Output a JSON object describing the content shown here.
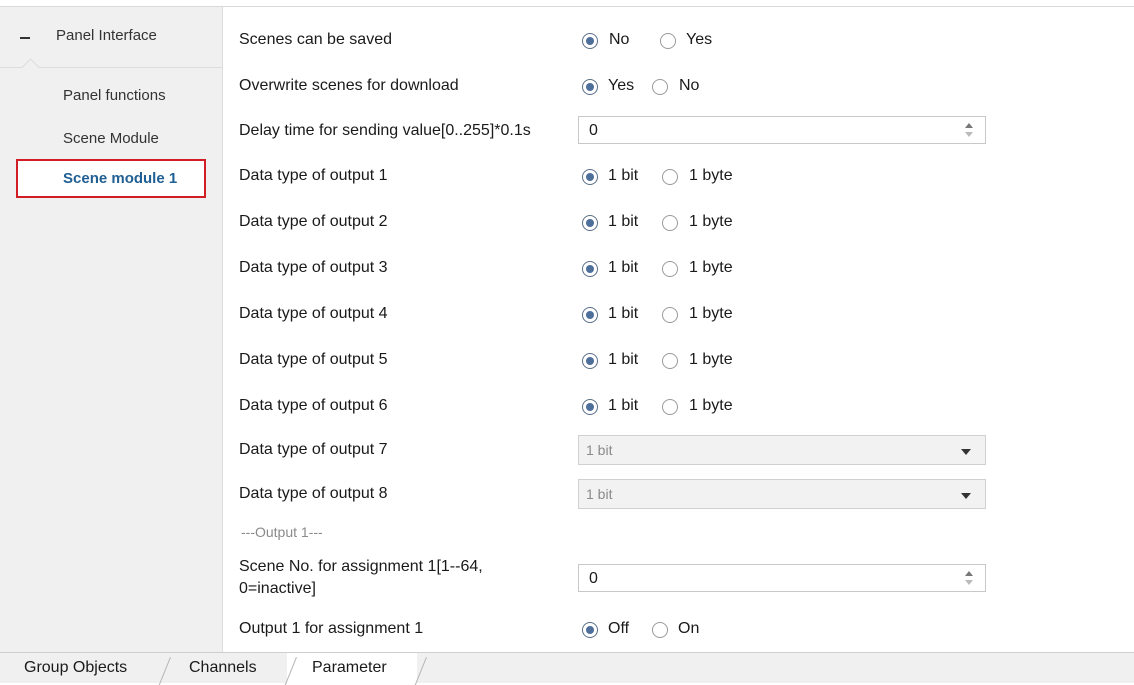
{
  "sidebar": {
    "root_label": "Panel Interface",
    "items": [
      "Panel functions",
      "Scene Module"
    ],
    "selected": "Scene module 1"
  },
  "params": {
    "scenes_saved": {
      "label": "Scenes can be saved",
      "opt1": "No",
      "opt2": "Yes",
      "selected": "No"
    },
    "overwrite": {
      "label": "Overwrite scenes for download",
      "opt1": "Yes",
      "opt2": "No",
      "selected": "Yes"
    },
    "delay": {
      "label": "Delay time for sending value[0..255]*0.1s",
      "value": "0"
    },
    "out1": {
      "label": "Data type of output 1",
      "opt1": "1 bit",
      "opt2": "1 byte",
      "selected": "1 bit"
    },
    "out2": {
      "label": "Data type of output 2",
      "opt1": "1 bit",
      "opt2": "1 byte",
      "selected": "1 bit"
    },
    "out3": {
      "label": "Data type of output 3",
      "opt1": "1 bit",
      "opt2": "1 byte",
      "selected": "1 bit"
    },
    "out4": {
      "label": "Data type of output 4",
      "opt1": "1 bit",
      "opt2": "1 byte",
      "selected": "1 bit"
    },
    "out5": {
      "label": "Data type of output 5",
      "opt1": "1 bit",
      "opt2": "1 byte",
      "selected": "1 bit"
    },
    "out6": {
      "label": "Data type of output 6",
      "opt1": "1 bit",
      "opt2": "1 byte",
      "selected": "1 bit"
    },
    "out7": {
      "label": "Data type of output 7",
      "value": "1 bit"
    },
    "out8": {
      "label": "Data type of output 8",
      "value": "1 bit"
    },
    "section_output1": "---Output 1---",
    "scene_no": {
      "label_line1": "Scene No. for assignment 1[1--64,",
      "label_line2": "0=inactive]",
      "value": "0"
    },
    "out1_assign": {
      "label": "Output 1 for assignment 1",
      "opt1": "Off",
      "opt2": "On",
      "selected": "Off"
    }
  },
  "tabs": [
    "Group Objects",
    "Channels",
    "Parameter"
  ],
  "active_tab": "Parameter",
  "colors": {
    "selection_border": "#d11e24",
    "selected_text": "#1f5f93",
    "radio_fill": "#4d6f9a"
  }
}
